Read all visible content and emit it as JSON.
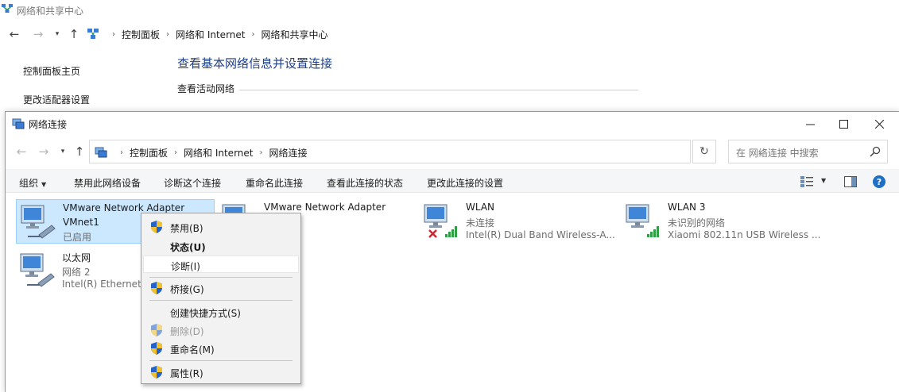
{
  "background": {
    "title": "网络和共享中心",
    "breadcrumb": [
      "控制面板",
      "网络和 Internet",
      "网络和共享中心"
    ],
    "sidebar": [
      "控制面板主页",
      "更改适配器设置"
    ],
    "heading": "查看基本网络信息并设置连接",
    "subheading": "查看活动网络"
  },
  "window": {
    "title": "网络连接",
    "breadcrumb": [
      "控制面板",
      "网络和 Internet",
      "网络连接"
    ],
    "search_placeholder": "在 网络连接 中搜索"
  },
  "toolbar": {
    "organize": "组织",
    "disable": "禁用此网络设备",
    "diagnose": "诊断这个连接",
    "rename": "重命名此连接",
    "status": "查看此连接的状态",
    "settings": "更改此连接的设置"
  },
  "adapters": [
    {
      "name": "VMware Network Adapter",
      "line2": "VMnet1",
      "status": "已启用",
      "device": "",
      "icon": "wired-adapter-icon",
      "selected": true
    },
    {
      "name": "VMware Network Adapter",
      "line2": "",
      "status": "",
      "device": "",
      "icon": "wired-adapter-icon",
      "selected": false
    },
    {
      "name": "WLAN",
      "line2": "",
      "status": "未连接",
      "device": "Intel(R) Dual Band Wireless-A...",
      "icon": "wireless-adapter-icon",
      "selected": false
    },
    {
      "name": "WLAN 3",
      "line2": "",
      "status": "未识别的网络",
      "device": "Xiaomi 802.11n USB Wireless ...",
      "icon": "wireless-adapter-icon",
      "selected": false
    },
    {
      "name": "以太网",
      "line2": "",
      "status": "网络 2",
      "device": "Intel(R) Ethernet C",
      "icon": "wired-adapter-icon",
      "selected": false
    }
  ],
  "context_menu": {
    "disable": "禁用(B)",
    "status": "状态(U)",
    "diagnose": "诊断(I)",
    "bridge": "桥接(G)",
    "shortcut": "创建快捷方式(S)",
    "delete": "删除(D)",
    "rename": "重命名(M)",
    "properties": "属性(R)"
  },
  "colors": {
    "selection": "#cce8ff",
    "link_heading": "#1e3f8a",
    "help_icon": "#1f6fc7",
    "signal_green": "#2ea043",
    "error_red": "#d8232a"
  }
}
